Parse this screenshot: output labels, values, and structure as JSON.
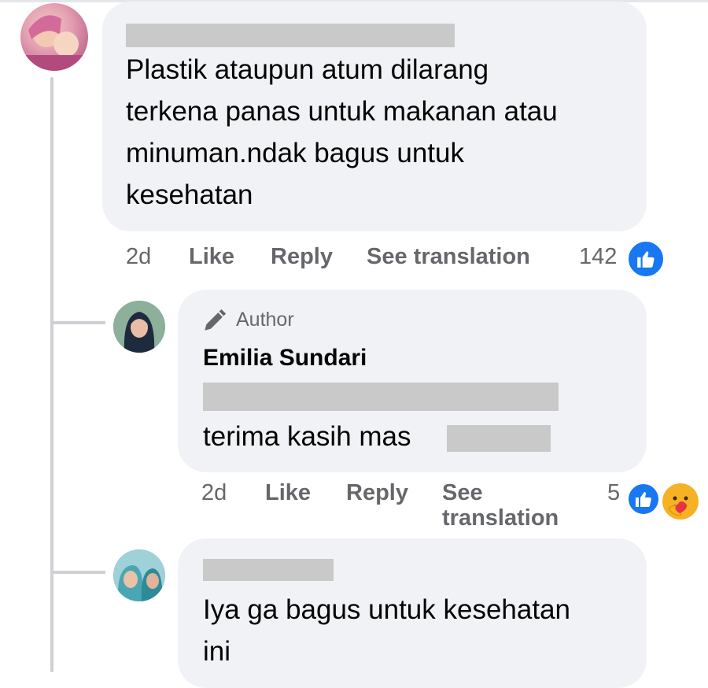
{
  "comment1": {
    "text_lines": [
      "Plastik ataupun atum dilarang",
      "terkena panas untuk makanan atau",
      "minuman.ndak bagus untuk",
      "kesehatan"
    ],
    "time": "2d",
    "like": "Like",
    "reply": "Reply",
    "see_translation": "See translation",
    "reaction_count": "142",
    "reaction_icons": [
      "like-icon"
    ]
  },
  "reply1": {
    "badge": "Author",
    "author": "Emilia Sundari",
    "text_line2": "terima kasih mas",
    "time": "2d",
    "like": "Like",
    "reply": "Reply",
    "see_translation_line1": "See",
    "see_translation_line2": "translation",
    "reaction_count": "5",
    "reaction_icons": [
      "like-icon",
      "care-icon"
    ]
  },
  "reply2": {
    "text_lines": [
      "Iya ga bagus untuk kesehatan",
      "ini"
    ]
  },
  "colors": {
    "bubble": "#f0f2f5",
    "secondary_text": "#65676b",
    "like_blue": "#1877f2",
    "thread_line": "#ced0d4"
  }
}
